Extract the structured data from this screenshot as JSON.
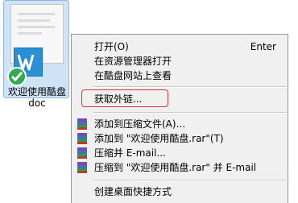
{
  "file": {
    "name": "欢迎使用酷盘",
    "ext": "doc"
  },
  "menu": {
    "items": [
      {
        "label": "打开(O)",
        "shortcut": "Enter"
      },
      {
        "label": "在资源管理器打开"
      },
      {
        "label": "在酷盘网站上查看"
      },
      {
        "label": "获取外链..."
      },
      {
        "label": "添加到压缩文件(A)...",
        "icon": "winrar-icon"
      },
      {
        "label": "添加到 \"欢迎使用酷盘.rar\"(T)",
        "icon": "winrar-icon"
      },
      {
        "label": "压缩并 E-mail...",
        "icon": "winrar-icon"
      },
      {
        "label": "压缩到 \"欢迎使用酷盘.rar\" 并 E-mail",
        "icon": "winrar-icon"
      },
      {
        "label": "创建桌面快捷方式"
      }
    ]
  },
  "colors": {
    "highlight_border": "#d23a3a",
    "menu_bg": "#f0f0f0",
    "word_blue": "#2b8fd6",
    "check_green": "#34a853"
  }
}
